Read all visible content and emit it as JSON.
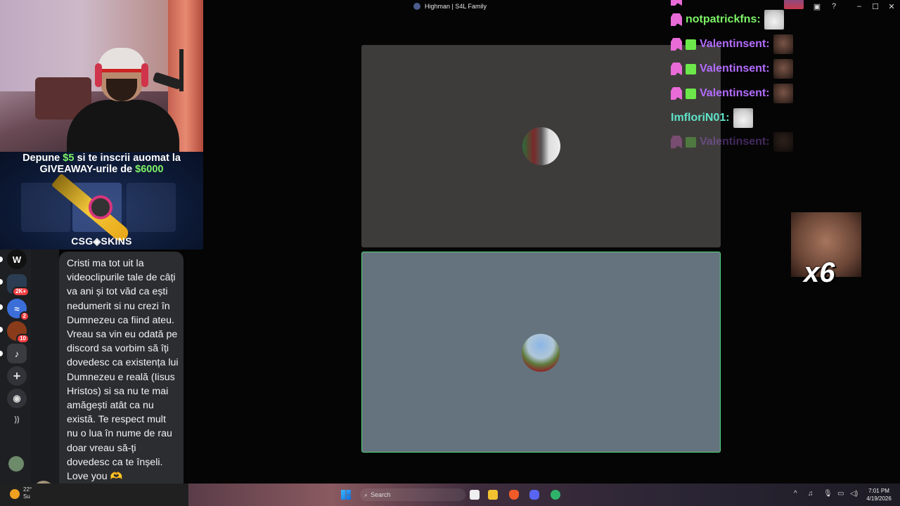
{
  "window": {
    "title": "Highman | S4L Family",
    "controls": [
      "inbox-icon",
      "help-icon",
      "minimize-icon",
      "maximize-icon",
      "close-icon"
    ]
  },
  "ad": {
    "line1_pre": "Depune ",
    "line1_amount": "$5",
    "line1_post": " si te inscrii auomat la",
    "line2_pre": "GIVEAWAY-urile de ",
    "line2_amount": "$6000",
    "logo": "CSG◈SKINS",
    "accent": "#7df266"
  },
  "rail": {
    "items": [
      {
        "icon": "w-server-icon",
        "text": "W",
        "badge": ""
      },
      {
        "icon": "server-stack-icon",
        "text": "",
        "badge": "2K+"
      },
      {
        "icon": "messenger-icon",
        "text": "",
        "badge": "2"
      },
      {
        "icon": "warrior-server-icon",
        "text": "",
        "badge": "10"
      },
      {
        "icon": "music-server-icon",
        "text": "♪",
        "badge": ""
      },
      {
        "icon": "add-server-icon",
        "text": "+",
        "badge": ""
      },
      {
        "icon": "explore-icon",
        "text": "◉",
        "badge": ""
      }
    ]
  },
  "message": {
    "text": "Cristi ma tot uit la videoclipurile tale de câți va ani și tot văd ca ești nedumerit si nu crezi în Dumnezeu ca fiind ateu. Vreau sa vin eu odată pe discord sa vorbim să îți dovedesc ca existența lui Dumnezeu e reală (Iisus Hristos) si sa nu te mai amăgești atât ca nu există. Te respect mult nu o lua în nume de rau doar vreau să-ți dovedesc ca te înșeli. Love you",
    "emoji": "🫶"
  },
  "chat": {
    "lines": [
      {
        "name": "notpatrickfns:",
        "color": "#7df266",
        "badges": [
          "sub"
        ],
        "emote": "cat"
      },
      {
        "name": "Valentinsent:",
        "color": "#b36cff",
        "badges": [
          "sub",
          "gift"
        ],
        "emote": "face"
      },
      {
        "name": "Valentinsent:",
        "color": "#b36cff",
        "badges": [
          "sub",
          "gift"
        ],
        "emote": "face"
      },
      {
        "name": "Valentinsent:",
        "color": "#b36cff",
        "badges": [
          "sub",
          "gift"
        ],
        "emote": "face"
      },
      {
        "name": "ImfloriN01:",
        "color": "#5fe4c9",
        "badges": [],
        "emote": "cat"
      },
      {
        "name": "Valentinsent:",
        "color": "#b36cff",
        "badges": [
          "sub",
          "gift"
        ],
        "emote": "face"
      }
    ],
    "combo": "x6"
  },
  "taskbar": {
    "weather_temp": "22°",
    "weather_desc": "Su",
    "search_placeholder": "Search",
    "time": "7:01 PM",
    "date": "4/19/2026"
  }
}
